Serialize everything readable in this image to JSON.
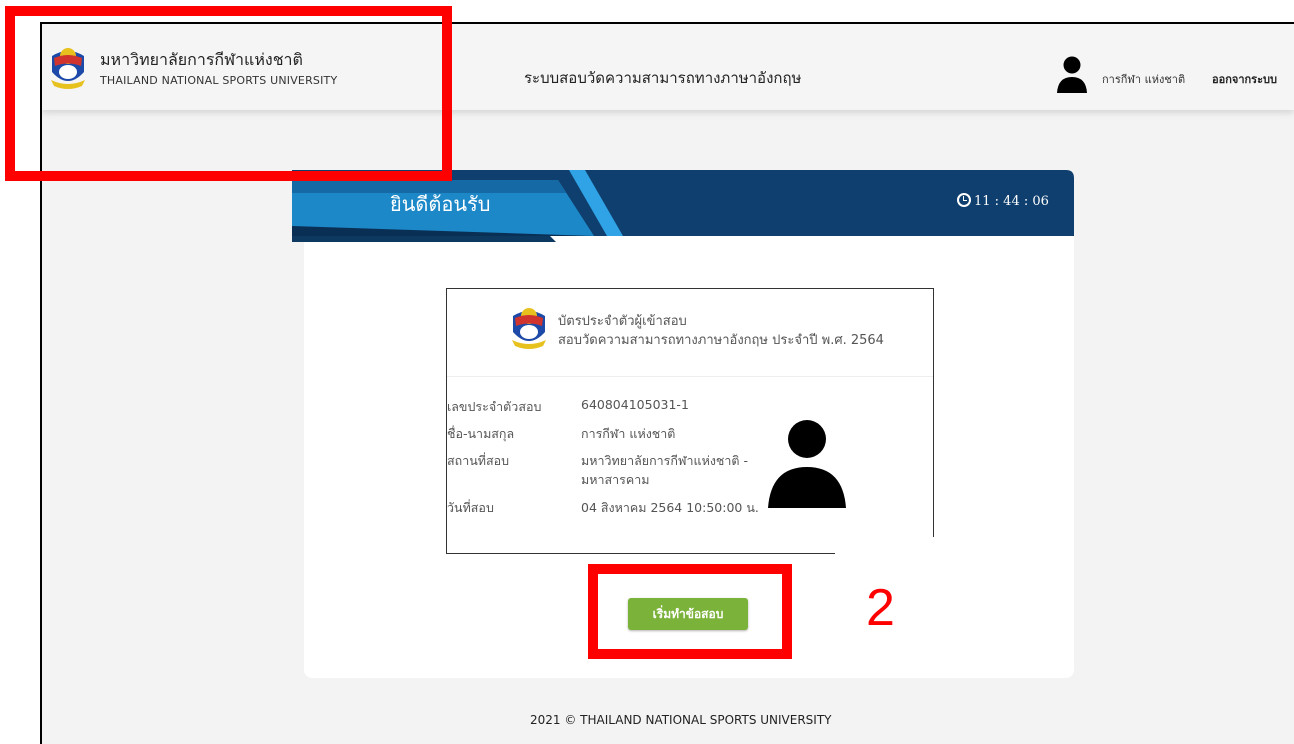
{
  "header": {
    "brand_th": "มหาวิทยาลัยการกีฬาแห่งชาติ",
    "brand_en": "THAILAND NATIONAL SPORTS UNIVERSITY",
    "system_title": "ระบบสอบวัดความสามารถทางภาษาอังกฤษ",
    "user_name": "การกีฬา แห่งชาติ",
    "logout_label": "ออกจากระบบ"
  },
  "banner": {
    "welcome": "ยินดีต้อนรับ",
    "timer": "11 : 44 : 06"
  },
  "exam_card": {
    "title": "บัตรประจำตัวผู้เข้าสอบ",
    "subtitle": "สอบวัดความสามารถทางภาษาอังกฤษ ประจำปี พ.ศ. 2564",
    "fields": [
      {
        "label": "เลขประจำตัวสอบ",
        "value": "640804105031-1"
      },
      {
        "label": "ชื่อ-นามสกุล",
        "value": "การกีฬา แห่งชาติ"
      },
      {
        "label": "สถานที่สอบ",
        "value": "มหาวิทยาลัยการกีฬาแห่งชาติ -",
        "value2": "มหาสารคาม"
      },
      {
        "label": "วันที่สอบ",
        "value": "04 สิงหาคม 2564 10:50:00 น."
      }
    ]
  },
  "start_button": "เริ่มทำข้อสอบ",
  "footer": "2021 © THAILAND NATIONAL SPORTS UNIVERSITY",
  "annotation": {
    "step": "2"
  },
  "colors": {
    "banner_dark": "#0f4272",
    "banner_light": "#1c86c6",
    "button": "#7bb23a",
    "highlight": "#ff0000"
  }
}
